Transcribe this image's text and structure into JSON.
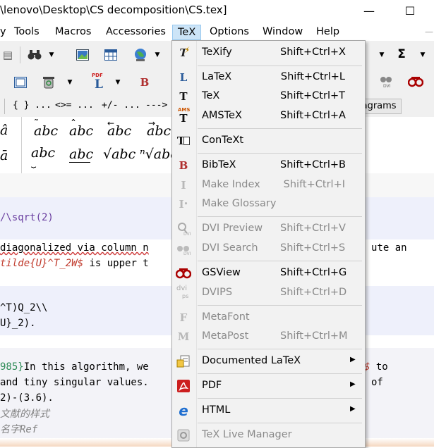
{
  "window": {
    "title": "\\lenovo\\Desktop\\CS decomposition\\CS.tex]",
    "minimize": "—",
    "maximize": "☐"
  },
  "menubar": [
    "y",
    "Tools",
    "Macros",
    "Accessories",
    "TeX",
    "Options",
    "Window",
    "Help"
  ],
  "symbol_tabs": [
    "{ } ...",
    "<>= ...",
    "+/- ...",
    "---> ...",
    "iagrams"
  ],
  "palette": {
    "row1": [
      "â",
      "abc",
      "abc",
      "abc",
      "abc"
    ],
    "row2": [
      "ā",
      "abc",
      "abc",
      "√abc",
      "ⁿ√abc"
    ]
  },
  "editor_lines": {
    "l1": "/\\sqrt(2)",
    "l2a": "diagonalized via column n",
    "l2b": "ute an",
    "l3a": "tilde{U}^T_2W$",
    "l3b": " is upper t",
    "l4": "^T)Q_2\\\\",
    "l5": "U}_2).",
    "l6a": "985}",
    "l6b": "In this algorithm, we",
    "l6c": "$",
    "l6d": " to",
    "l7a": "and tiny singular values.",
    "l7b": "of",
    "l8": "2)-(3.6).",
    "l9": "文献的样式",
    "l10": "名字Ref"
  },
  "tex_menu": {
    "items": [
      {
        "label": "TeXify",
        "shortcut": "Shift+Ctrl+X",
        "icon": "texify-icon",
        "enabled": true
      },
      {
        "label": "LaTeX",
        "shortcut": "Shift+Ctrl+L",
        "icon": "latex-icon",
        "enabled": true
      },
      {
        "label": "TeX",
        "shortcut": "Shift+Ctrl+T",
        "icon": "tex-icon",
        "enabled": true
      },
      {
        "label": "AMSTeX",
        "shortcut": "Shift+Ctrl+A",
        "icon": "amstex-icon",
        "enabled": true
      },
      {
        "label": "ConTeXt",
        "shortcut": "",
        "icon": "context-icon",
        "enabled": true
      },
      {
        "label": "BibTeX",
        "shortcut": "Shift+Ctrl+B",
        "icon": "bibtex-icon",
        "enabled": true
      },
      {
        "label": "Make Index",
        "shortcut": "Shift+Ctrl+I",
        "icon": "makeindex-icon",
        "enabled": false
      },
      {
        "label": "Make Glossary",
        "shortcut": "",
        "icon": "makeglossary-icon",
        "enabled": false
      },
      {
        "label": "DVI Preview",
        "shortcut": "Shift+Ctrl+V",
        "icon": "dvi-preview-icon",
        "enabled": false
      },
      {
        "label": "DVI Search",
        "shortcut": "Shift+Ctrl+S",
        "icon": "dvi-search-icon",
        "enabled": false
      },
      {
        "label": "GSView",
        "shortcut": "Shift+Ctrl+G",
        "icon": "gsview-icon",
        "enabled": true
      },
      {
        "label": "DVIPS",
        "shortcut": "Shift+Ctrl+D",
        "icon": "dvips-icon",
        "enabled": false
      },
      {
        "label": "MetaFont",
        "shortcut": "",
        "icon": "metafont-icon",
        "enabled": false
      },
      {
        "label": "MetaPost",
        "shortcut": "Shift+Ctrl+M",
        "icon": "metapost-icon",
        "enabled": false
      },
      {
        "label": "Documented LaTeX",
        "shortcut": "",
        "icon": "documented-latex-icon",
        "enabled": true,
        "submenu": true
      },
      {
        "label": "PDF",
        "shortcut": "",
        "icon": "pdf-icon",
        "enabled": true,
        "submenu": true
      },
      {
        "label": "HTML",
        "shortcut": "",
        "icon": "html-icon",
        "enabled": true,
        "submenu": true
      },
      {
        "label": "TeX Live Manager",
        "shortcut": "",
        "icon": "texlive-manager-icon",
        "enabled": false
      }
    ],
    "submenu_arrow": "▶",
    "icon_glyphs": {
      "texify": "T",
      "latex": "L",
      "tex": "T",
      "amstex_top": "AMS",
      "amstex": "T",
      "context": "T",
      "bibtex": "B",
      "makeindex": "I",
      "makeglossary": "I",
      "dvi_sub": "DVI",
      "dvips_top": "dvi",
      "dvips_sub": "ps",
      "metafont": "F",
      "metapost": "M",
      "html": "e"
    }
  },
  "toolbar": {
    "sigma": "Σ",
    "binoculars": "🔍",
    "bold_b": "B",
    "pdf_tag": "PDF",
    "pdf_letter": "L",
    "dvi_tag": "DVI"
  },
  "colors": {
    "menu_highlight": "#cce4f7",
    "bibtex": "#b03030",
    "pdf_red": "#cc1f1f",
    "html_blue": "#1f6fd0",
    "code_green": "#2e8b57",
    "code_red": "#c0392b",
    "code_band": "#eef0fb"
  }
}
